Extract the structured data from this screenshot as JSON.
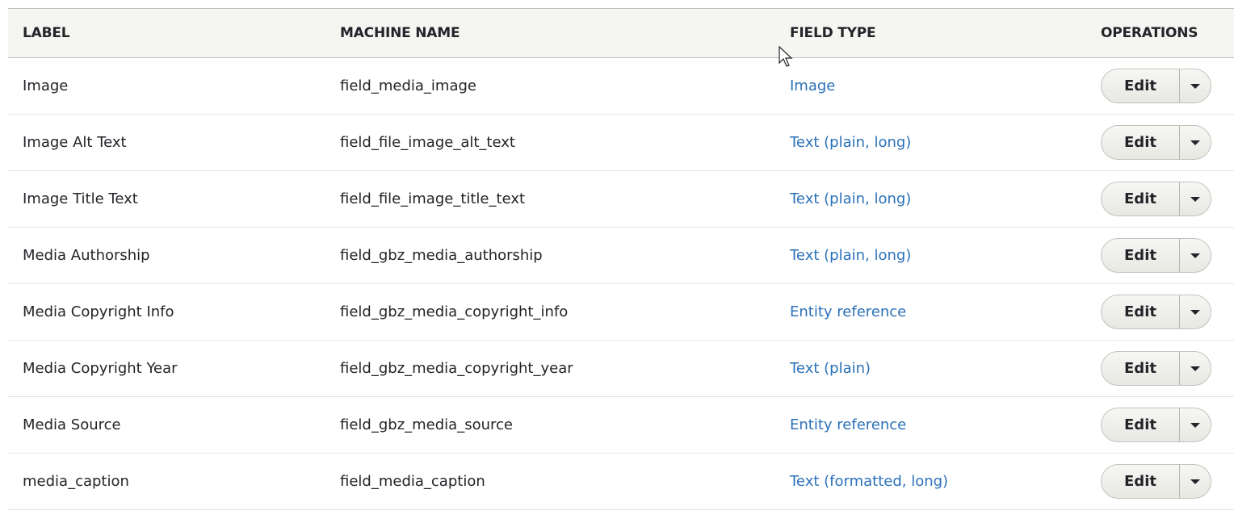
{
  "columns": [
    "LABEL",
    "MACHINE NAME",
    "FIELD TYPE",
    "OPERATIONS"
  ],
  "rows": [
    {
      "label": "Image",
      "machine": "field_media_image",
      "type": "Image"
    },
    {
      "label": "Image Alt Text",
      "machine": "field_file_image_alt_text",
      "type": "Text (plain, long)"
    },
    {
      "label": "Image Title Text",
      "machine": "field_file_image_title_text",
      "type": "Text (plain, long)"
    },
    {
      "label": "Media Authorship",
      "machine": "field_gbz_media_authorship",
      "type": "Text (plain, long)"
    },
    {
      "label": "Media Copyright Info",
      "machine": "field_gbz_media_copyright_info",
      "type": "Entity reference"
    },
    {
      "label": "Media Copyright Year",
      "machine": "field_gbz_media_copyright_year",
      "type": "Text (plain)"
    },
    {
      "label": "Media Source",
      "machine": "field_gbz_media_source",
      "type": "Entity reference"
    },
    {
      "label": "media_caption",
      "machine": "field_media_caption",
      "type": "Text (formatted, long)"
    }
  ],
  "edit_label": "Edit",
  "colors": {
    "link": "#2c71b8",
    "header_bg": "#f5f5f2"
  }
}
